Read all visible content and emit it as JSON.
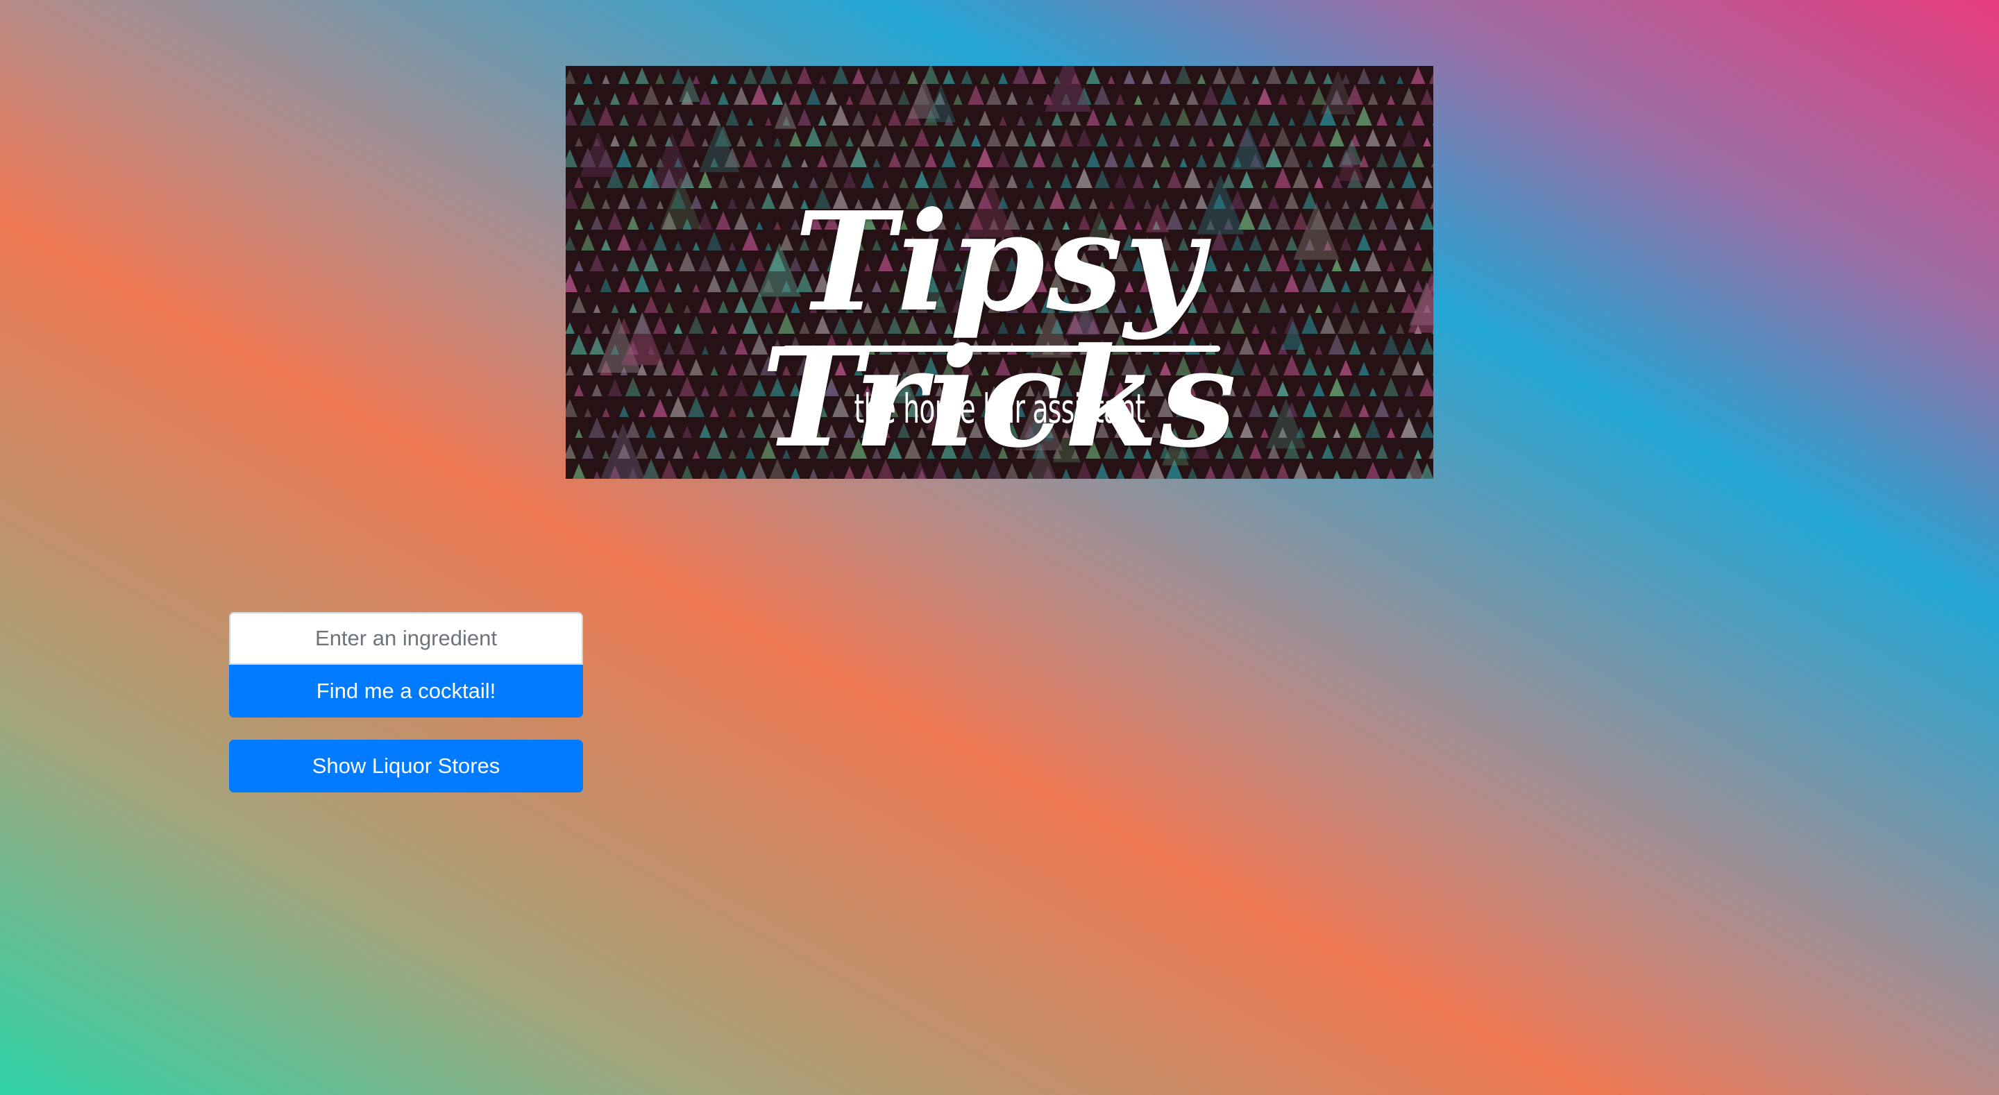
{
  "banner": {
    "title": "Tipsy Tricks",
    "subtitle": "the home bar assistant"
  },
  "search": {
    "placeholder": "Enter an ingredient",
    "value": ""
  },
  "buttons": {
    "find_label": "Find me a cocktail!",
    "stores_label": "Show Liquor Stores"
  },
  "colors": {
    "primary_button": "#007bff",
    "gradient_stops": [
      "#2fd3a8",
      "#ee7752",
      "#23a6d5",
      "#e73c7e"
    ]
  }
}
